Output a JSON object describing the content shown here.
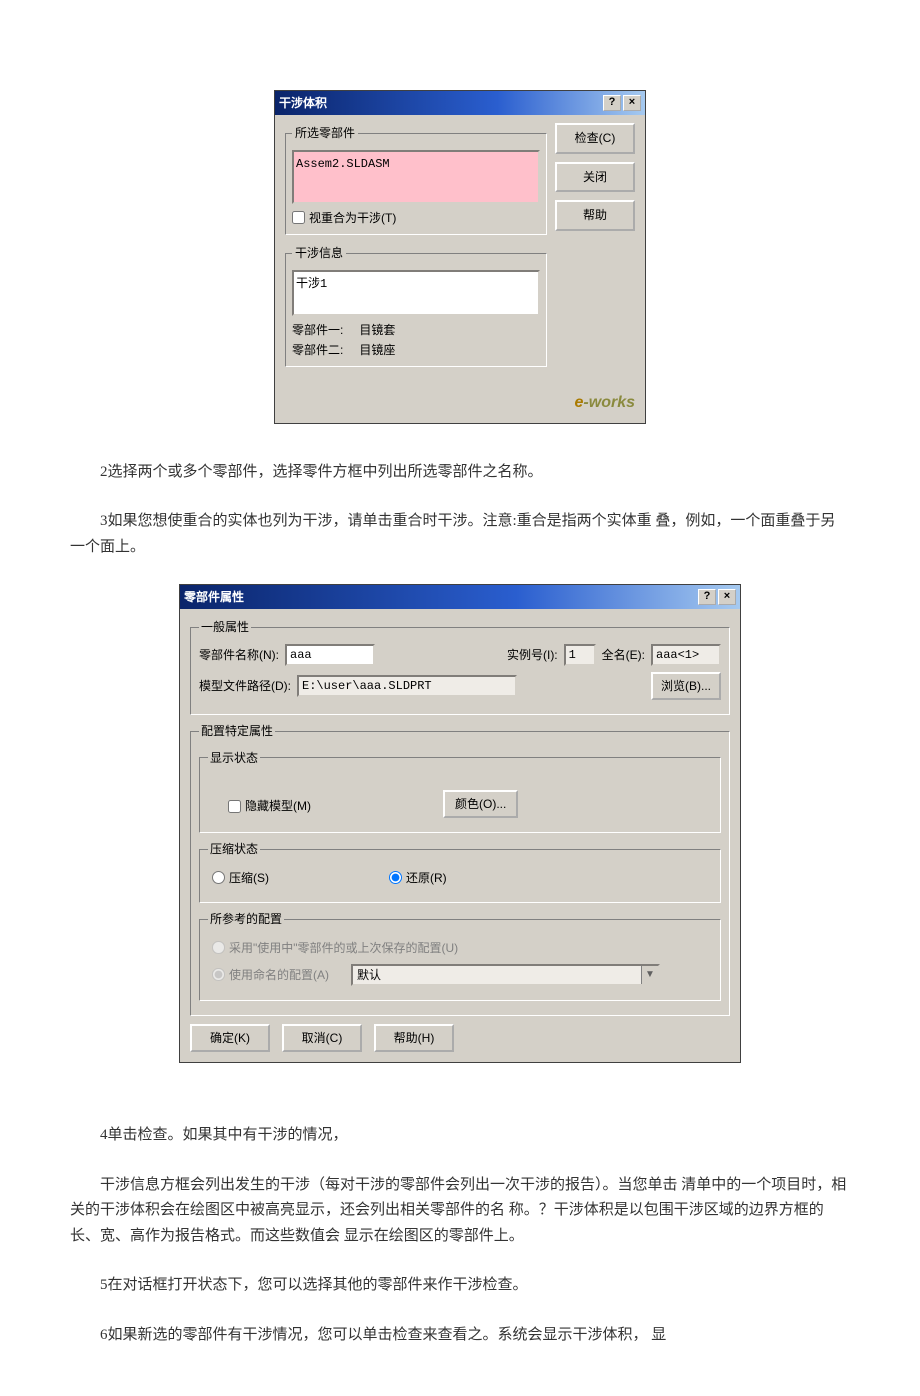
{
  "dialog1": {
    "title": "干涉体积",
    "group_selected": {
      "legend": "所选零部件",
      "item": "Assem2.SLDASM",
      "checkbox_label": "视重合为干涉(T)"
    },
    "buttons": {
      "check": "检查(C)",
      "close": "关闭",
      "help": "帮助"
    },
    "group_info": {
      "legend": "干涉信息",
      "item": "干涉1",
      "row1_label": "零部件一:",
      "row1_value": "目镜套",
      "row2_label": "零部件二:",
      "row2_value": "目镜座"
    },
    "logo_pre": "e",
    "logo_text": "-works"
  },
  "text1": "2选择两个或多个零部件，选择零件方框中列出所选零部件之名称。",
  "text2": "3如果您想使重合的实体也列为干涉，请单击重合时干涉。注意:重合是指两个实体重 叠，例如，一个面重叠于另一个面上。",
  "dialog2": {
    "title": "零部件属性",
    "general": {
      "legend": "一般属性",
      "name_label": "零部件名称(N):",
      "name_value": "aaa",
      "instance_label": "实例号(I):",
      "instance_value": "1",
      "fullname_label": "全名(E):",
      "fullname_value": "aaa<1>",
      "path_label": "模型文件路径(D):",
      "path_value": "E:\\user\\aaa.SLDPRT",
      "browse_btn": "浏览(B)..."
    },
    "config_specific": {
      "legend": "配置特定属性",
      "display": {
        "legend": "显示状态",
        "hide_label": "隐藏模型(M)",
        "color_btn": "颜色(O)..."
      },
      "suppress": {
        "legend": "压缩状态",
        "radio_suppress": "压缩(S)",
        "radio_resolve": "还原(R)"
      },
      "ref_config": {
        "legend": "所参考的配置",
        "radio_use_inplace": "采用\"使用中\"零部件的或上次保存的配置(U)",
        "radio_use_name": "使用命名的配置(A)",
        "select_value": "默认"
      }
    },
    "ok": "确定(K)",
    "cancel": "取消(C)",
    "help": "帮助(H)"
  },
  "text3": "4单击检查。如果其中有干涉的情况，",
  "text4": "干涉信息方框会列出发生的干涉（每对干涉的零部件会列出一次干涉的报告）。当您单击 清单中的一个项目时，相关的干涉体积会在绘图区中被高亮显示，还会列出相关零部件的名 称。？干涉体积是以包围干涉区域的边界方框的长、宽、高作为报告格式。而这些数值会 显示在绘图区的零部件上。",
  "text5": "5在对话框打开状态下，您可以选择其他的零部件来作干涉检查。",
  "text6": "6如果新选的零部件有干涉情况，您可以单击检查来查看之。系统会显示干涉体积， 显"
}
